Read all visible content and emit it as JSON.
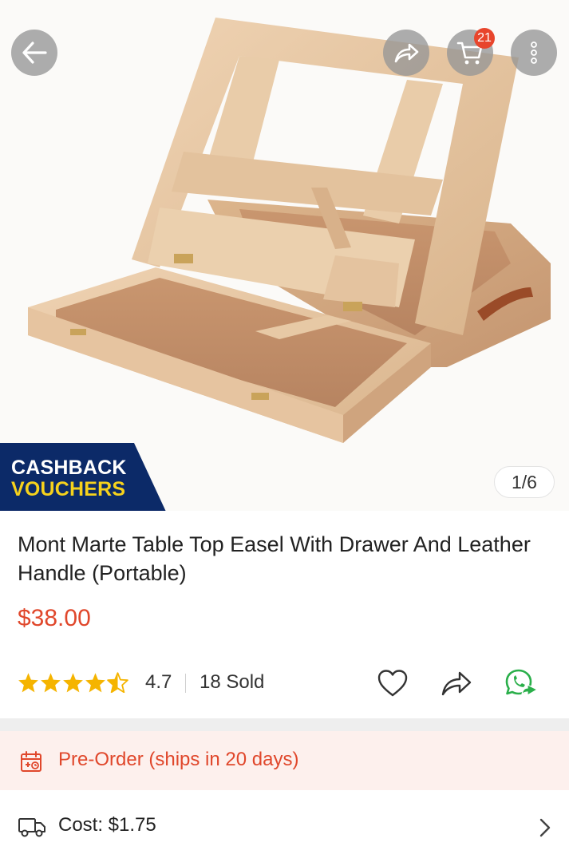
{
  "header": {
    "cart_count": "21"
  },
  "gallery": {
    "promo_line1": "CASHBACK",
    "promo_line2": "VOUCHERS",
    "pager": "1/6",
    "rating_stars": 4.7
  },
  "product": {
    "title": "Mont Marte Table Top Easel With Drawer And Leather Handle (Portable)",
    "price": "$38.00",
    "rating": "4.7",
    "sold": "18 Sold"
  },
  "shipping": {
    "preorder_text": "Pre-Order (ships in 20 days)",
    "cost_text": "Cost: $1.75"
  },
  "colors": {
    "accent": "#e0472b",
    "promo_bg": "#0c2a68",
    "promo_yellow": "#f6d21c",
    "star": "#f5b400",
    "whatsapp": "#2aaf4a"
  }
}
